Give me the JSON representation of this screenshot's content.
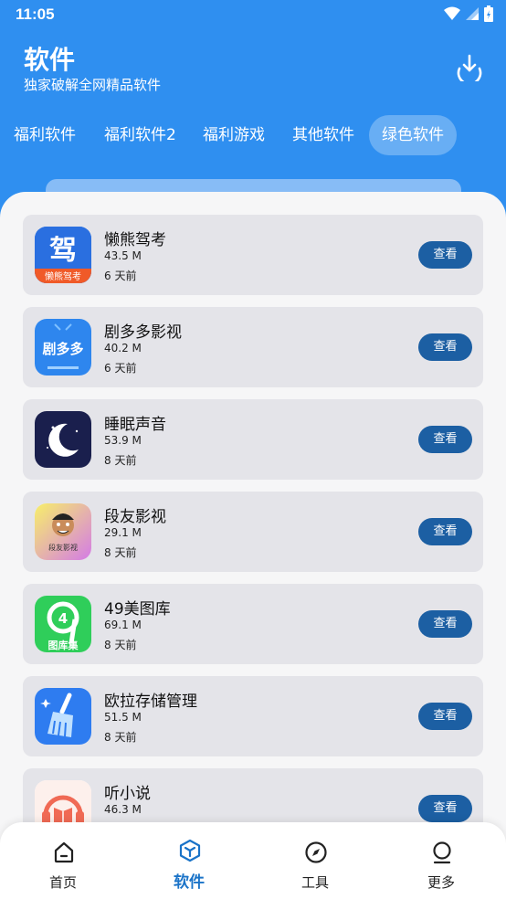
{
  "status_bar": {
    "time": "11:05",
    "icons": [
      "wifi-icon",
      "signal-icon",
      "battery-icon"
    ]
  },
  "header": {
    "title": "软件",
    "subtitle": "独家破解全网精品软件",
    "download_icon": "download-icon"
  },
  "tabs": [
    {
      "label": "福利软件",
      "active": false
    },
    {
      "label": "福利软件2",
      "active": false
    },
    {
      "label": "福利游戏",
      "active": false
    },
    {
      "label": "其他软件",
      "active": false
    },
    {
      "label": "绿色软件",
      "active": true
    }
  ],
  "apps": [
    {
      "name": "懒熊驾考",
      "size": "43.5 M",
      "date": "6 天前",
      "button": "查看",
      "icon": "driving-test-icon",
      "icon_text": "驾",
      "icon_caption": "懒熊驾考"
    },
    {
      "name": "剧多多影视",
      "size": "40.2 M",
      "date": "6 天前",
      "button": "查看",
      "icon": "tv-icon",
      "icon_text": "剧多多",
      "icon_caption": ""
    },
    {
      "name": "睡眠声音",
      "size": "53.9 M",
      "date": "8 天前",
      "button": "查看",
      "icon": "moon-icon"
    },
    {
      "name": "段友影视",
      "size": "29.1 M",
      "date": "8 天前",
      "button": "查看",
      "icon": "cartoon-face-icon",
      "icon_caption": "段友影视"
    },
    {
      "name": "49美图库",
      "size": "69.1 M",
      "date": "8 天前",
      "button": "查看",
      "icon": "number-49-icon",
      "icon_text": "4",
      "icon_caption": "图库集"
    },
    {
      "name": "欧拉存储管理",
      "size": "51.5 M",
      "date": "8 天前",
      "button": "查看",
      "icon": "broom-icon"
    },
    {
      "name": "听小说",
      "size": "46.3 M",
      "date": "",
      "button": "查看",
      "icon": "headphone-book-icon"
    }
  ],
  "bottom_nav": [
    {
      "label": "首页",
      "icon": "home-icon",
      "active": false
    },
    {
      "label": "软件",
      "icon": "cube-icon",
      "active": true
    },
    {
      "label": "工具",
      "icon": "compass-icon",
      "active": false
    },
    {
      "label": "更多",
      "icon": "user-icon",
      "active": false
    }
  ],
  "colors": {
    "primary": "#2f8ff0",
    "button": "#1c5fa3",
    "active_nav": "#1a73c8"
  }
}
